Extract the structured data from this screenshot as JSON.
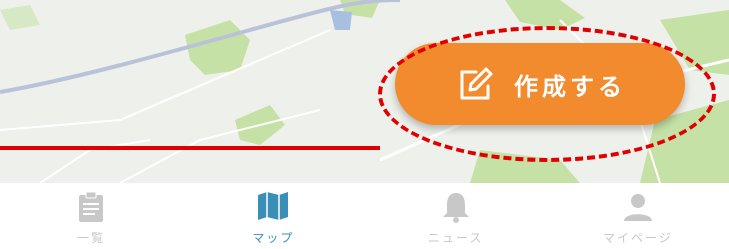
{
  "create_button": {
    "label": "作成する",
    "icon": "edit-icon"
  },
  "tabs": [
    {
      "label": "一覧",
      "icon": "clipboard-icon",
      "active": false
    },
    {
      "label": "マップ",
      "icon": "map-icon",
      "active": true
    },
    {
      "label": "ニュース",
      "icon": "bell-icon",
      "active": false
    },
    {
      "label": "マイページ",
      "icon": "person-icon",
      "active": false
    }
  ],
  "colors": {
    "accent": "#f28a2e",
    "tab_active": "#3a8fb7",
    "tab_inactive": "#c8c8c8",
    "highlight": "#e00000"
  }
}
